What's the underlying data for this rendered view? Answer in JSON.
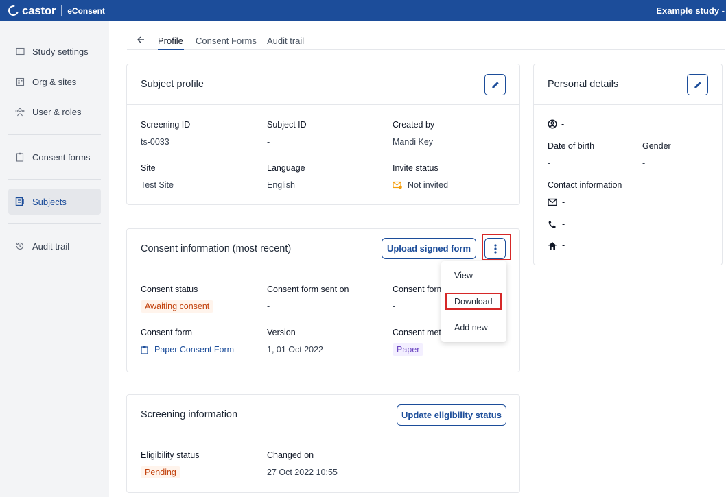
{
  "topbar": {
    "logo": "castor",
    "product": "eConsent",
    "study": "Example study -"
  },
  "sidebar": {
    "items": [
      {
        "label": "Study settings"
      },
      {
        "label": "Org & sites"
      },
      {
        "label": "User & roles"
      },
      {
        "label": "Consent forms"
      },
      {
        "label": "Subjects"
      },
      {
        "label": "Audit trail"
      }
    ]
  },
  "tabs": [
    {
      "label": "Profile"
    },
    {
      "label": "Consent Forms"
    },
    {
      "label": "Audit trail"
    }
  ],
  "subject_profile": {
    "title": "Subject profile",
    "fields": {
      "screening_id": {
        "label": "Screening ID",
        "value": "ts-0033"
      },
      "subject_id": {
        "label": "Subject ID",
        "value": "-"
      },
      "created_by": {
        "label": "Created by",
        "value": "Mandi Key"
      },
      "site": {
        "label": "Site",
        "value": "Test Site"
      },
      "language": {
        "label": "Language",
        "value": "English"
      },
      "invite_status": {
        "label": "Invite status",
        "value": "Not invited"
      }
    }
  },
  "consent_info": {
    "title": "Consent information (most recent)",
    "upload_label": "Upload signed form",
    "fields": {
      "consent_status": {
        "label": "Consent status",
        "value": "Awaiting consent"
      },
      "sent_on": {
        "label": "Consent form sent on",
        "value": "-"
      },
      "consent_form_col3": {
        "label": "Consent form",
        "value": "-"
      },
      "consent_form": {
        "label": "Consent form",
        "value": "Paper Consent Form"
      },
      "version": {
        "label": "Version",
        "value": "1, 01 Oct 2022"
      },
      "consent_method": {
        "label": "Consent met",
        "value": "Paper"
      }
    },
    "menu": [
      {
        "label": "View"
      },
      {
        "label": "Download"
      },
      {
        "label": "Add new"
      }
    ]
  },
  "screening_info": {
    "title": "Screening information",
    "update_label": "Update eligibility status",
    "fields": {
      "eligibility": {
        "label": "Eligibility status",
        "value": "Pending"
      },
      "changed_on": {
        "label": "Changed on",
        "value": "27 Oct 2022 10:55"
      }
    }
  },
  "personal_details": {
    "title": "Personal details",
    "name": "-",
    "dob": {
      "label": "Date of birth",
      "value": "-"
    },
    "gender": {
      "label": "Gender",
      "value": "-"
    },
    "contact_label": "Contact information",
    "email": "-",
    "phone": "-",
    "address": "-"
  },
  "colors": {
    "brand": "#1c4d9a",
    "highlight": "#d62828",
    "status_orange": "#c2410c",
    "tag_purple": "#6b46c1"
  }
}
